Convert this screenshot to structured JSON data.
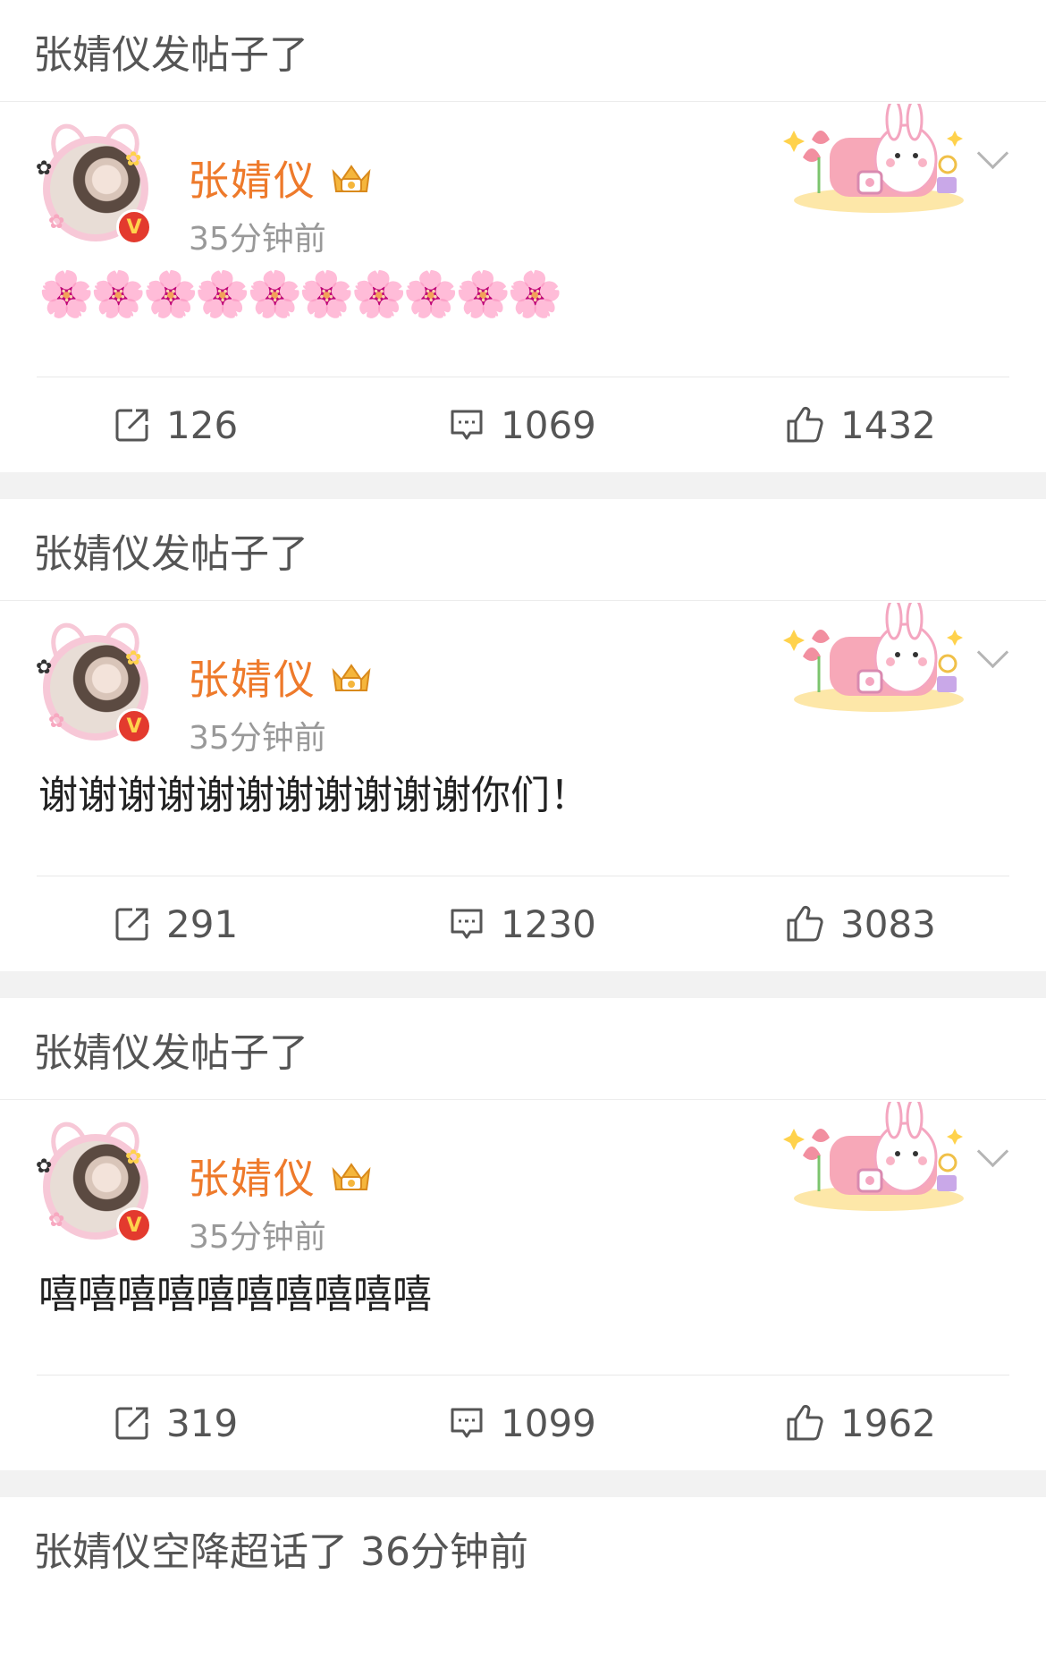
{
  "posts": [
    {
      "header": "张婧仪发帖子了",
      "name": "张婧仪",
      "time": "35分钟前",
      "content": "🌸🌸🌸🌸🌸🌸🌸🌸🌸🌸",
      "is_emoji": true,
      "reposts": "126",
      "comments": "1069",
      "likes": "1432"
    },
    {
      "header": "张婧仪发帖子了",
      "name": "张婧仪",
      "time": "35分钟前",
      "content": "谢谢谢谢谢谢谢谢谢谢谢你们！",
      "is_emoji": false,
      "reposts": "291",
      "comments": "1230",
      "likes": "3083"
    },
    {
      "header": "张婧仪发帖子了",
      "name": "张婧仪",
      "time": "35分钟前",
      "content": "嘻嘻嘻嘻嘻嘻嘻嘻嘻嘻",
      "is_emoji": false,
      "reposts": "319",
      "comments": "1099",
      "likes": "1962"
    }
  ],
  "last_item": {
    "header": "张婧仪空降超话了 36分钟前"
  },
  "icons": {
    "repost": "repost-icon",
    "comment": "comment-icon",
    "like": "thumbs-up-icon",
    "more": "chevron-down-icon",
    "verified": "verified-v-badge",
    "crown": "crown-badge-icon"
  },
  "colors": {
    "name": "#ee7a2b",
    "verified": "#e33a2e",
    "background": "#f2f2f2"
  }
}
